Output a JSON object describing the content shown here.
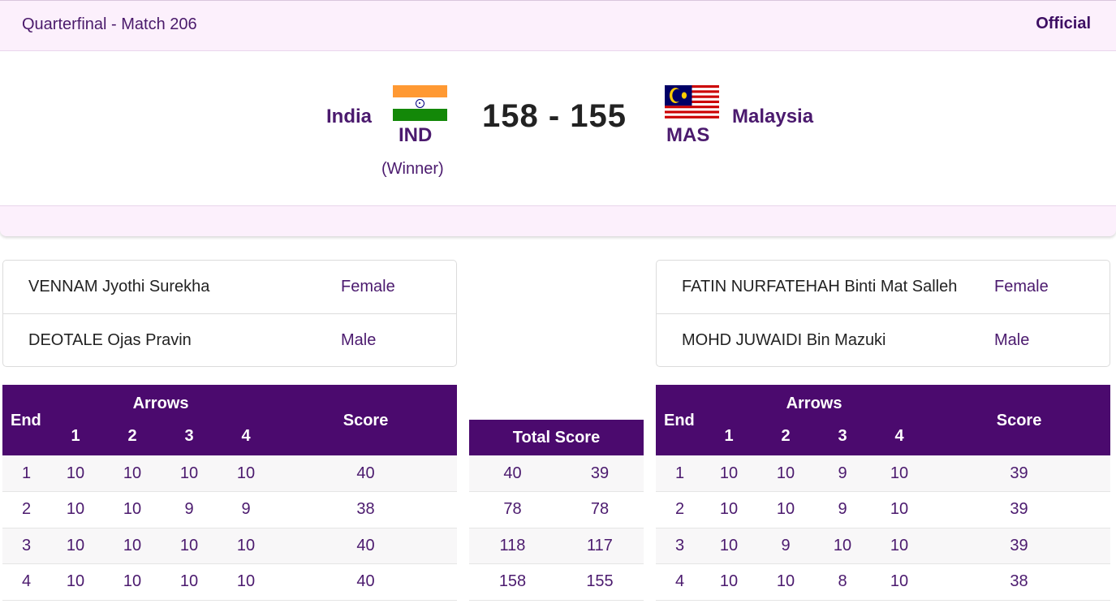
{
  "header": {
    "stage": "Quarterfinal  - Match 206",
    "status": "Official"
  },
  "match": {
    "left_team": {
      "name": "India",
      "code": "IND",
      "result": "(Winner)"
    },
    "right_team": {
      "name": "Malaysia",
      "code": "MAS"
    },
    "score": "158 - 155"
  },
  "rosters": {
    "left": [
      {
        "name": "VENNAM Jyothi Surekha",
        "gender": "Female"
      },
      {
        "name": "DEOTALE Ojas Pravin",
        "gender": "Male"
      }
    ],
    "right": [
      {
        "name": "FATIN NURFATEHAH Binti Mat Salleh",
        "gender": "Female"
      },
      {
        "name": "MOHD JUWAIDI Bin Mazuki",
        "gender": "Male"
      }
    ]
  },
  "table_labels": {
    "end": "End",
    "arrows": "Arrows",
    "score": "Score",
    "arrow_numbers": [
      "1",
      "2",
      "3",
      "4"
    ],
    "total_score": "Total Score"
  },
  "left_ends": [
    {
      "end": "1",
      "arrows": [
        "10",
        "10",
        "10",
        "10"
      ],
      "score": "40"
    },
    {
      "end": "2",
      "arrows": [
        "10",
        "10",
        "9",
        "9"
      ],
      "score": "38"
    },
    {
      "end": "3",
      "arrows": [
        "10",
        "10",
        "10",
        "10"
      ],
      "score": "40"
    },
    {
      "end": "4",
      "arrows": [
        "10",
        "10",
        "10",
        "10"
      ],
      "score": "40"
    }
  ],
  "right_ends": [
    {
      "end": "1",
      "arrows": [
        "10",
        "10",
        "9",
        "10"
      ],
      "score": "39"
    },
    {
      "end": "2",
      "arrows": [
        "10",
        "10",
        "9",
        "10"
      ],
      "score": "39"
    },
    {
      "end": "3",
      "arrows": [
        "10",
        "9",
        "10",
        "10"
      ],
      "score": "39"
    },
    {
      "end": "4",
      "arrows": [
        "10",
        "10",
        "8",
        "10"
      ],
      "score": "38"
    }
  ],
  "totals": [
    {
      "left": "40",
      "right": "39"
    },
    {
      "left": "78",
      "right": "78"
    },
    {
      "left": "118",
      "right": "117"
    },
    {
      "left": "158",
      "right": "155"
    }
  ],
  "colors": {
    "header_purple": "#4b0a6e",
    "text_purple": "#4b1a6e",
    "lavender": "#fcf0fc"
  },
  "icons": {
    "left_flag": "india-flag-icon",
    "right_flag": "malaysia-flag-icon"
  }
}
